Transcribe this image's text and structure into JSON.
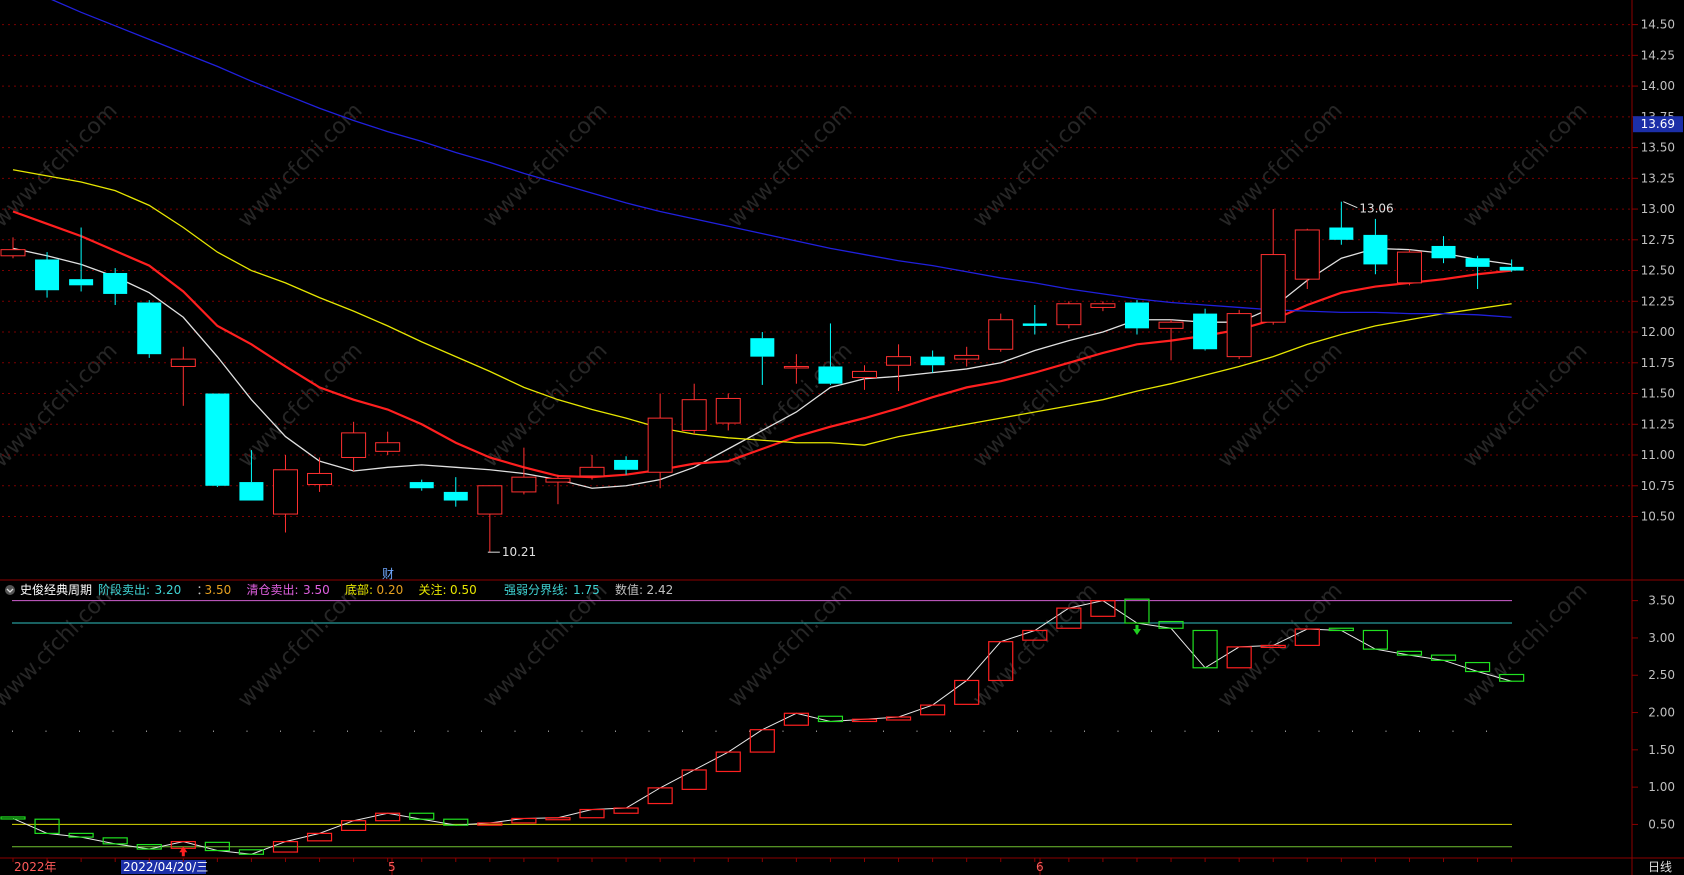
{
  "chart_data": [
    {
      "type": "candlestick",
      "name_role": "main-price-panel",
      "y_ticks": [
        "14.50",
        "14.25",
        "14.00",
        "13.75",
        "13.50",
        "13.25",
        "13.00",
        "12.75",
        "12.50",
        "12.25",
        "12.00",
        "11.75",
        "11.50",
        "11.25",
        "11.00",
        "10.75",
        "10.50"
      ],
      "ylim": [
        10.0,
        14.7
      ],
      "current_price_label": "13.69",
      "current_price": 13.69,
      "high_annotation": "13.06",
      "high_value": 13.06,
      "low_annotation": "10.21",
      "low_value": 10.21,
      "finance_marker": "财",
      "candles": [
        {
          "o": 12.62,
          "c": 12.67,
          "h": 12.77,
          "l": 12.6
        },
        {
          "o": 12.59,
          "c": 12.34,
          "h": 12.65,
          "l": 12.28
        },
        {
          "o": 12.43,
          "c": 12.38,
          "h": 12.85,
          "l": 12.33
        },
        {
          "o": 12.48,
          "c": 12.31,
          "h": 12.52,
          "l": 12.22
        },
        {
          "o": 12.24,
          "c": 11.82,
          "h": 12.26,
          "l": 11.79
        },
        {
          "o": 11.72,
          "c": 11.78,
          "h": 11.88,
          "l": 11.4
        },
        {
          "o": 11.5,
          "c": 10.75,
          "h": 11.5,
          "l": 10.74
        },
        {
          "o": 10.78,
          "c": 10.63,
          "h": 11.04,
          "l": 10.63
        },
        {
          "o": 10.52,
          "c": 10.88,
          "h": 11.0,
          "l": 10.37
        },
        {
          "o": 10.76,
          "c": 10.85,
          "h": 10.98,
          "l": 10.7
        },
        {
          "o": 10.98,
          "c": 11.18,
          "h": 11.27,
          "l": 10.87
        },
        {
          "o": 11.03,
          "c": 11.1,
          "h": 11.19,
          "l": 11.0
        },
        {
          "o": 10.78,
          "c": 10.73,
          "h": 10.8,
          "l": 10.71
        },
        {
          "o": 10.7,
          "c": 10.63,
          "h": 10.82,
          "l": 10.58
        },
        {
          "o": 10.52,
          "c": 10.75,
          "h": 10.75,
          "l": 10.21
        },
        {
          "o": 10.7,
          "c": 10.82,
          "h": 11.06,
          "l": 10.68
        },
        {
          "o": 10.78,
          "c": 10.81,
          "h": 10.84,
          "l": 10.6
        },
        {
          "o": 10.83,
          "c": 10.9,
          "h": 11.0,
          "l": 10.8
        },
        {
          "o": 10.96,
          "c": 10.88,
          "h": 10.99,
          "l": 10.84
        },
        {
          "o": 10.86,
          "c": 11.3,
          "h": 11.5,
          "l": 10.73
        },
        {
          "o": 11.2,
          "c": 11.45,
          "h": 11.58,
          "l": 11.17
        },
        {
          "o": 11.26,
          "c": 11.46,
          "h": 11.5,
          "l": 11.2
        },
        {
          "o": 11.95,
          "c": 11.8,
          "h": 12.0,
          "l": 11.57
        },
        {
          "o": 11.72,
          "c": 11.72,
          "h": 11.82,
          "l": 11.58
        },
        {
          "o": 11.72,
          "c": 11.58,
          "h": 12.07,
          "l": 11.57
        },
        {
          "o": 11.63,
          "c": 11.68,
          "h": 11.73,
          "l": 11.53
        },
        {
          "o": 11.73,
          "c": 11.8,
          "h": 11.9,
          "l": 11.52
        },
        {
          "o": 11.8,
          "c": 11.73,
          "h": 11.85,
          "l": 11.67
        },
        {
          "o": 11.78,
          "c": 11.81,
          "h": 11.88,
          "l": 11.72
        },
        {
          "o": 11.86,
          "c": 12.1,
          "h": 12.15,
          "l": 11.84
        },
        {
          "o": 12.07,
          "c": 12.05,
          "h": 12.22,
          "l": 11.98
        },
        {
          "o": 12.06,
          "c": 12.23,
          "h": 12.25,
          "l": 12.03
        },
        {
          "o": 12.2,
          "c": 12.23,
          "h": 12.25,
          "l": 12.17
        },
        {
          "o": 12.24,
          "c": 12.03,
          "h": 12.26,
          "l": 11.98
        },
        {
          "o": 12.03,
          "c": 12.08,
          "h": 12.1,
          "l": 11.77
        },
        {
          "o": 12.15,
          "c": 11.86,
          "h": 12.19,
          "l": 11.85
        },
        {
          "o": 11.8,
          "c": 12.15,
          "h": 12.18,
          "l": 11.78
        },
        {
          "o": 12.08,
          "c": 12.63,
          "h": 13.0,
          "l": 12.06
        },
        {
          "o": 12.43,
          "c": 12.83,
          "h": 12.84,
          "l": 12.35
        },
        {
          "o": 12.85,
          "c": 12.75,
          "h": 13.06,
          "l": 12.71
        },
        {
          "o": 12.79,
          "c": 12.55,
          "h": 12.92,
          "l": 12.47
        },
        {
          "o": 12.4,
          "c": 12.65,
          "h": 12.67,
          "l": 12.38
        },
        {
          "o": 12.7,
          "c": 12.6,
          "h": 12.78,
          "l": 12.56
        },
        {
          "o": 12.6,
          "c": 12.53,
          "h": 12.62,
          "l": 12.35
        },
        {
          "o": 12.53,
          "c": 12.5,
          "h": 12.59,
          "l": 12.49
        }
      ],
      "series": [
        {
          "role": "ma-short",
          "color": "#e0e0e0",
          "values": [
            12.68,
            12.62,
            12.55,
            12.45,
            12.32,
            12.12,
            11.8,
            11.45,
            11.15,
            10.95,
            10.87,
            10.9,
            10.92,
            10.9,
            10.88,
            10.85,
            10.8,
            10.73,
            10.75,
            10.8,
            10.9,
            11.05,
            11.2,
            11.35,
            11.55,
            11.62,
            11.64,
            11.67,
            11.7,
            11.75,
            11.85,
            11.93,
            12.0,
            12.1,
            12.1,
            12.08,
            12.08,
            12.2,
            12.42,
            12.6,
            12.68,
            12.67,
            12.64,
            12.59,
            12.55
          ]
        },
        {
          "role": "ma-mid",
          "color": "#ff1f1f",
          "values": [
            12.98,
            12.88,
            12.78,
            12.66,
            12.54,
            12.33,
            12.05,
            11.9,
            11.72,
            11.55,
            11.45,
            11.37,
            11.25,
            11.1,
            10.98,
            10.9,
            10.83,
            10.82,
            10.84,
            10.88,
            10.93,
            10.95,
            11.05,
            11.15,
            11.23,
            11.3,
            11.38,
            11.47,
            11.55,
            11.6,
            11.67,
            11.75,
            11.83,
            11.9,
            11.93,
            11.97,
            12.02,
            12.1,
            12.22,
            12.32,
            12.37,
            12.4,
            12.43,
            12.47,
            12.5
          ]
        },
        {
          "role": "ma-long",
          "color": "#e6e600",
          "values": [
            13.32,
            13.27,
            13.22,
            13.15,
            13.03,
            12.85,
            12.65,
            12.5,
            12.4,
            12.28,
            12.17,
            12.05,
            11.92,
            11.8,
            11.68,
            11.55,
            11.45,
            11.37,
            11.3,
            11.22,
            11.17,
            11.14,
            11.12,
            11.1,
            11.1,
            11.08,
            11.15,
            11.2,
            11.25,
            11.3,
            11.35,
            11.4,
            11.45,
            11.52,
            11.58,
            11.65,
            11.72,
            11.8,
            11.9,
            11.98,
            12.05,
            12.1,
            12.15,
            12.19,
            12.23
          ]
        },
        {
          "role": "ma-120",
          "color": "#2020dd",
          "values": [
            14.83,
            14.72,
            14.6,
            14.49,
            14.38,
            14.27,
            14.16,
            14.04,
            13.93,
            13.82,
            13.72,
            13.63,
            13.55,
            13.46,
            13.38,
            13.29,
            13.21,
            13.13,
            13.05,
            12.98,
            12.92,
            12.86,
            12.8,
            12.74,
            12.68,
            12.63,
            12.58,
            12.54,
            12.49,
            12.44,
            12.4,
            12.35,
            12.31,
            12.27,
            12.24,
            12.22,
            12.2,
            12.18,
            12.17,
            12.16,
            12.16,
            12.15,
            12.15,
            12.14,
            12.12
          ]
        }
      ],
      "x_labels": [
        "2022年",
        "2022/04/20/三",
        "5",
        "6"
      ],
      "period_label": "日线"
    },
    {
      "type": "candlestick",
      "name_role": "indicator-panel",
      "indicator_name": "史俊经典周期",
      "legend": [
        {
          "label": "阶段卖出:",
          "value": "3.20",
          "color": "#3fd3d3"
        },
        {
          "label": "",
          "value": "3.50",
          "color": "#e6a020"
        },
        {
          "label": "清仓卖出:",
          "value": "3.50",
          "color": "#e060e0"
        },
        {
          "label": "底部:",
          "value": "0.20",
          "color": "#e6e600"
        },
        {
          "label": "关注:",
          "value": "0.50",
          "color": "#e6e600"
        },
        {
          "label": "强弱分界线:",
          "value": "1.75",
          "color": "#3fd3d3"
        },
        {
          "label": "数值:",
          "value": "2.42",
          "color": "#c0c0c0"
        }
      ],
      "y_ticks": [
        "3.50",
        "3.00",
        "2.50",
        "2.00",
        "1.50",
        "1.00",
        "0.50"
      ],
      "ylim": [
        0.05,
        3.75
      ],
      "hlines": [
        {
          "value": 3.5,
          "color": "#d060d0"
        },
        {
          "value": 3.2,
          "color": "#30c0c0"
        },
        {
          "value": 0.5,
          "color": "#d8d800"
        },
        {
          "value": 0.2,
          "color": "#70c030"
        }
      ],
      "dotted_level": 1.75,
      "candles": [
        {
          "o": 0.6,
          "c": 0.58
        },
        {
          "o": 0.57,
          "c": 0.38
        },
        {
          "o": 0.38,
          "c": 0.33
        },
        {
          "o": 0.32,
          "c": 0.24
        },
        {
          "o": 0.23,
          "c": 0.17
        },
        {
          "o": 0.18,
          "c": 0.27
        },
        {
          "o": 0.26,
          "c": 0.15
        },
        {
          "o": 0.16,
          "c": 0.1
        },
        {
          "o": 0.13,
          "c": 0.27
        },
        {
          "o": 0.28,
          "c": 0.38
        },
        {
          "o": 0.42,
          "c": 0.55
        },
        {
          "o": 0.55,
          "c": 0.65
        },
        {
          "o": 0.65,
          "c": 0.57
        },
        {
          "o": 0.57,
          "c": 0.49
        },
        {
          "o": 0.49,
          "c": 0.52
        },
        {
          "o": 0.52,
          "c": 0.58
        },
        {
          "o": 0.58,
          "c": 0.59
        },
        {
          "o": 0.59,
          "c": 0.7
        },
        {
          "o": 0.65,
          "c": 0.72
        },
        {
          "o": 0.78,
          "c": 0.99
        },
        {
          "o": 0.97,
          "c": 1.23
        },
        {
          "o": 1.21,
          "c": 1.47
        },
        {
          "o": 1.47,
          "c": 1.77
        },
        {
          "o": 1.83,
          "c": 1.99
        },
        {
          "o": 1.95,
          "c": 1.88
        },
        {
          "o": 1.88,
          "c": 1.91
        },
        {
          "o": 1.9,
          "c": 1.94
        },
        {
          "o": 1.97,
          "c": 2.1
        },
        {
          "o": 2.11,
          "c": 2.43
        },
        {
          "o": 2.43,
          "c": 2.95
        },
        {
          "o": 2.97,
          "c": 3.1
        },
        {
          "o": 3.13,
          "c": 3.4
        },
        {
          "o": 3.29,
          "c": 3.5
        },
        {
          "o": 3.52,
          "c": 3.2
        },
        {
          "o": 3.22,
          "c": 3.13
        },
        {
          "o": 3.1,
          "c": 2.6
        },
        {
          "o": 2.6,
          "c": 2.88
        },
        {
          "o": 2.88,
          "c": 2.9
        },
        {
          "o": 2.9,
          "c": 3.12
        },
        {
          "o": 3.13,
          "c": 3.1
        },
        {
          "o": 3.1,
          "c": 2.85
        },
        {
          "o": 2.82,
          "c": 2.77
        },
        {
          "o": 2.77,
          "c": 2.7
        },
        {
          "o": 2.67,
          "c": 2.55
        },
        {
          "o": 2.51,
          "c": 2.42
        }
      ],
      "signals": [
        {
          "index": 5,
          "kind": "buy-arrow",
          "color": "#ff2020"
        },
        {
          "index": 33,
          "kind": "sell-arrow",
          "color": "#20d020"
        }
      ]
    }
  ],
  "watermark": "www.cfchi.com",
  "colors": {
    "up": "#ff3030",
    "down": "#00ffff",
    "grid": "#7a0000",
    "frame": "#8b0000",
    "axis_text": "#c0c0c0",
    "ind_up": "#ff2020",
    "ind_down": "#20e020",
    "ind_line": "#e8e8e8"
  }
}
